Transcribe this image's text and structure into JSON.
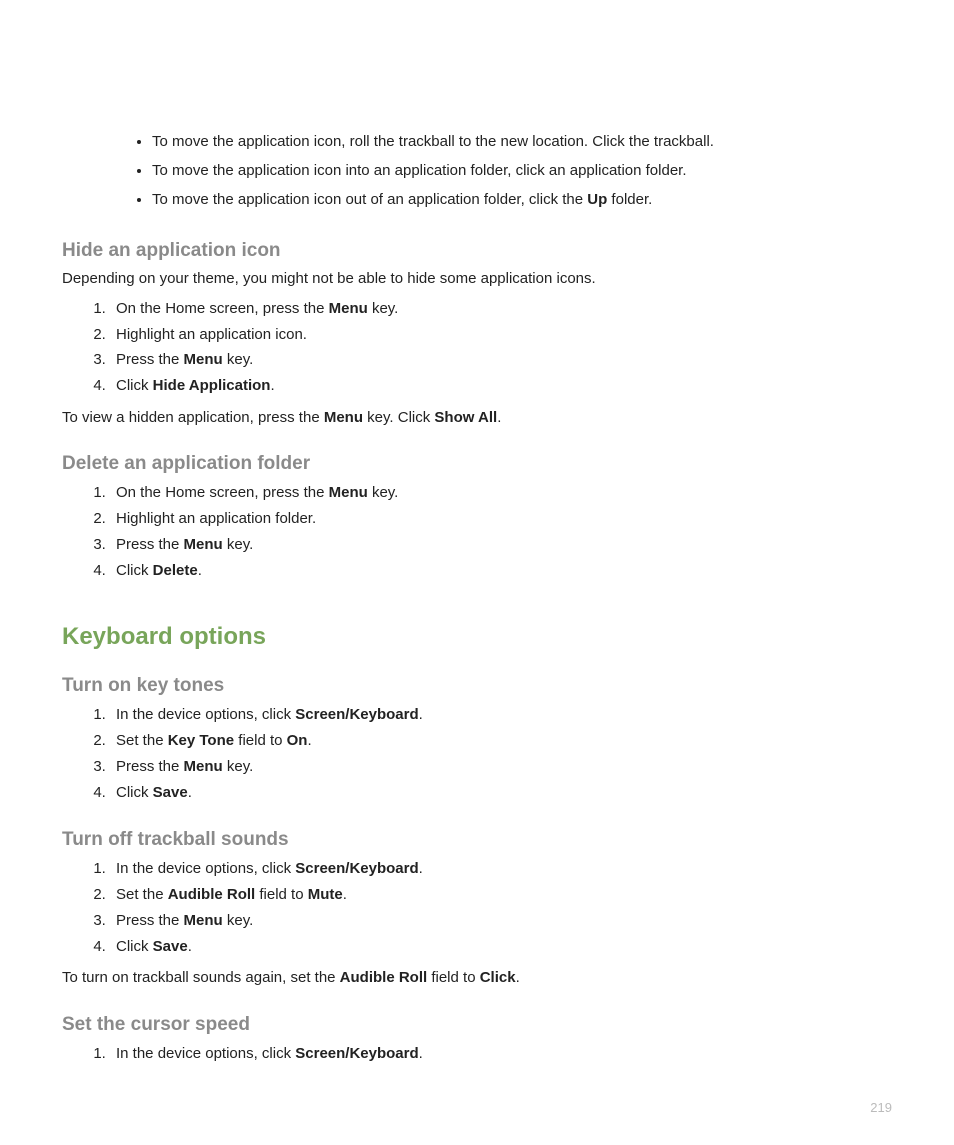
{
  "intro_bullets": [
    {
      "pre": "To move the application icon, roll the trackball to the new location. Click the trackball.",
      "bold": "",
      "post": ""
    },
    {
      "pre": "To move the application icon into an application folder, click an application folder.",
      "bold": "",
      "post": ""
    },
    {
      "pre": "To move the application icon out of an application folder, click the ",
      "bold": "Up",
      "post": " folder."
    }
  ],
  "hide": {
    "heading": "Hide an application icon",
    "intro": "Depending on your theme, you might not be able to hide some application icons.",
    "steps": [
      {
        "pre": "On the Home screen, press the ",
        "bold": "Menu",
        "post": " key."
      },
      {
        "pre": "Highlight an application icon.",
        "bold": "",
        "post": ""
      },
      {
        "pre": "Press the ",
        "bold": "Menu",
        "post": " key."
      },
      {
        "pre": "Click ",
        "bold": "Hide Application",
        "post": "."
      }
    ],
    "after_pre": "To view a hidden application, press the ",
    "after_b1": "Menu",
    "after_mid": " key. Click ",
    "after_b2": "Show All",
    "after_post": "."
  },
  "delete": {
    "heading": "Delete an application folder",
    "steps": [
      {
        "pre": "On the Home screen, press the ",
        "bold": "Menu",
        "post": " key."
      },
      {
        "pre": "Highlight an application folder.",
        "bold": "",
        "post": ""
      },
      {
        "pre": "Press the ",
        "bold": "Menu",
        "post": " key."
      },
      {
        "pre": "Click ",
        "bold": "Delete",
        "post": "."
      }
    ]
  },
  "keyboard_section": "Keyboard options",
  "keytones": {
    "heading": "Turn on key tones",
    "steps": [
      {
        "pre": "In the device options, click ",
        "bold": "Screen/Keyboard",
        "post": "."
      },
      {
        "pre": "Set the ",
        "bold": "Key Tone",
        "post_mid": " field to ",
        "bold2": "On",
        "post": "."
      },
      {
        "pre": "Press the ",
        "bold": "Menu",
        "post": " key."
      },
      {
        "pre": "Click ",
        "bold": "Save",
        "post": "."
      }
    ]
  },
  "trackball": {
    "heading": "Turn off trackball sounds",
    "steps": [
      {
        "pre": "In the device options, click ",
        "bold": "Screen/Keyboard",
        "post": "."
      },
      {
        "pre": "Set the ",
        "bold": "Audible Roll",
        "post_mid": " field to ",
        "bold2": "Mute",
        "post": "."
      },
      {
        "pre": "Press the ",
        "bold": "Menu",
        "post": " key."
      },
      {
        "pre": "Click ",
        "bold": "Save",
        "post": "."
      }
    ],
    "after_pre": "To turn on trackball sounds again, set the ",
    "after_b1": "Audible Roll",
    "after_mid": " field to ",
    "after_b2": "Click",
    "after_post": "."
  },
  "cursor": {
    "heading": "Set the cursor speed",
    "steps": [
      {
        "pre": "In the device options, click ",
        "bold": "Screen/Keyboard",
        "post": "."
      }
    ]
  },
  "page_number": "219"
}
